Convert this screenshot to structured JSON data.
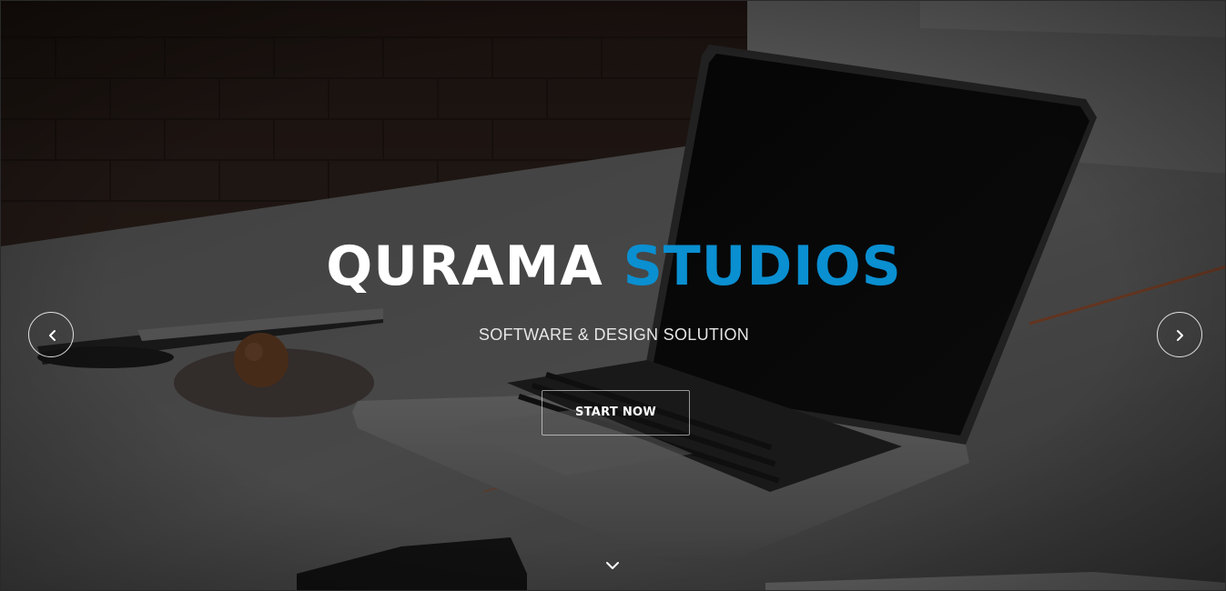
{
  "hero": {
    "title_part1": "QURAMA",
    "title_part2": "STUDIOS",
    "subtitle": "SOFTWARE & DESIGN SOLUTION",
    "cta_label": "START NOW"
  },
  "controls": {
    "prev_icon": "chevron-left-icon",
    "next_icon": "chevron-right-icon",
    "scroll_icon": "chevron-down-icon"
  },
  "colors": {
    "accent": "#0a8fd1",
    "title": "#ffffff",
    "overlay": "#000000"
  }
}
